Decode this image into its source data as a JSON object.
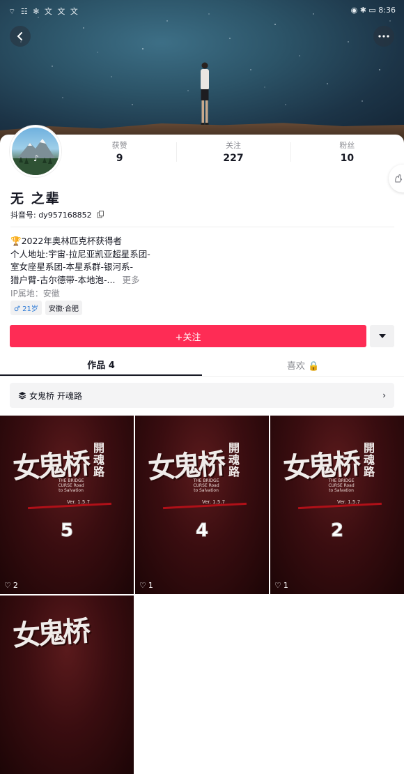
{
  "status_bar": {
    "left_icons": "⌔ ☷ ✻ 文 文 文",
    "time": "8:36"
  },
  "profile": {
    "stats": [
      {
        "label": "获赞",
        "value": "9"
      },
      {
        "label": "关注",
        "value": "227"
      },
      {
        "label": "粉丝",
        "value": "10"
      }
    ],
    "name": "无  之辈",
    "douyin_id_label": "抖音号: ",
    "douyin_id": "dy957168852",
    "bio_lines": [
      "🏆2022年奥林匹克杯获得者",
      "个人地址:宇宙-拉尼亚凯亚超星系团-",
      "室女座星系团-本星系群-银河系-",
      "猎户臂-古尔德带-本地泡-..."
    ],
    "bio_more": "更多",
    "ip_label": "IP属地：安徽",
    "tags": [
      "♂ 21岁",
      "安徽·合肥"
    ]
  },
  "actions": {
    "follow_label": "+关注"
  },
  "tabs": [
    {
      "label": "作品 4",
      "active": true
    },
    {
      "label": "喜欢 🔒",
      "active": false
    }
  ],
  "collection": {
    "label": "女鬼桥 开魂路"
  },
  "works": [
    {
      "number": "5",
      "likes": "2",
      "title": "女鬼桥",
      "vertical": "開魂路",
      "subtitle": "THE BRIDGE CURSE Road to Salvation",
      "version": "Ver. 1.5.7"
    },
    {
      "number": "4",
      "likes": "1",
      "title": "女鬼桥",
      "vertical": "開魂路",
      "subtitle": "THE BRIDGE CURSE Road to Salvation",
      "version": "Ver. 1.5.7"
    },
    {
      "number": "2",
      "likes": "1",
      "title": "女鬼桥",
      "vertical": "開魂路",
      "subtitle": "THE BRIDGE CURSE Road to Salvation",
      "version": "Ver. 1.5.7"
    },
    {
      "number": "",
      "likes": "",
      "title": "女鬼桥",
      "vertical": "",
      "subtitle": "",
      "version": ""
    }
  ]
}
